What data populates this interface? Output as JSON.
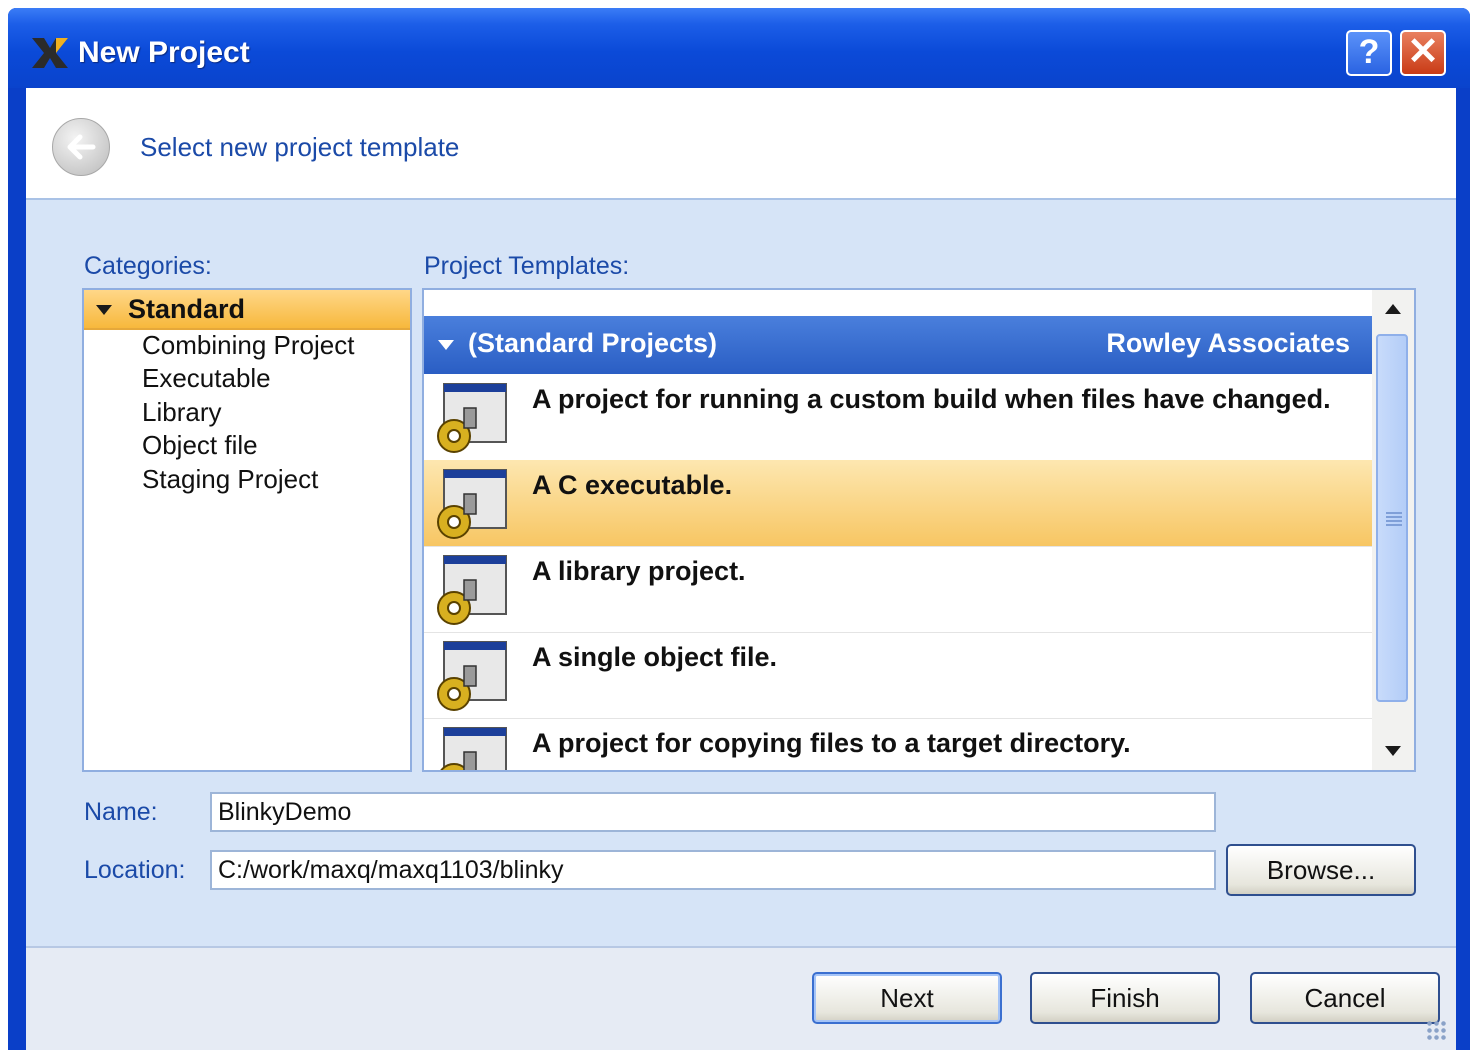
{
  "window": {
    "title": "New Project",
    "help_label": "?",
    "close_label": "✕"
  },
  "header": {
    "title": "Select new project template"
  },
  "categories": {
    "label": "Categories:",
    "group": "Standard",
    "items": [
      "Combining Project",
      "Executable",
      "Library",
      "Object file",
      "Staging Project"
    ]
  },
  "templates": {
    "label": "Project Templates:",
    "group_name": "(Standard Projects)",
    "group_vendor": "Rowley Associates",
    "items": [
      "A project for running a custom build when files have changed.",
      "A C executable.",
      "A library project.",
      "A single object file.",
      "A project for copying files to a target directory."
    ],
    "selected_index": 1
  },
  "form": {
    "name_label": "Name:",
    "name_value": "BlinkyDemo",
    "location_label": "Location:",
    "location_value": "C:/work/maxq/maxq1103/blinky",
    "browse_label": "Browse..."
  },
  "buttons": {
    "next": "Next",
    "finish": "Finish",
    "cancel": "Cancel"
  },
  "colors": {
    "titlebar": "#0a43cc",
    "selection": "#f7c663",
    "group_header": "#2a5ec4",
    "label_text": "#1b4aa8"
  }
}
